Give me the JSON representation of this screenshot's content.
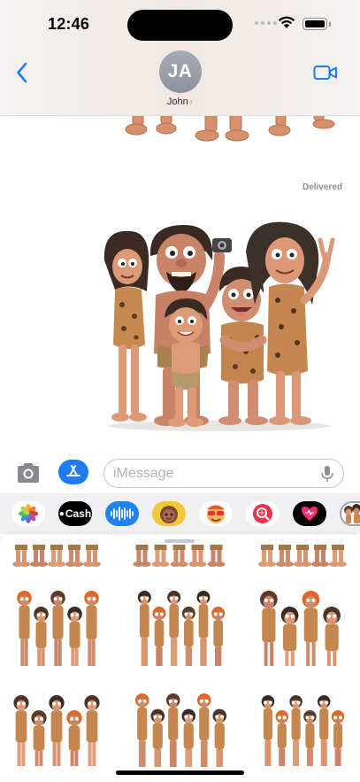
{
  "status_bar": {
    "time": "12:46"
  },
  "header": {
    "contact_initials": "JA",
    "contact_name": "John",
    "chevron": "›",
    "back_icon": "chevron-left-icon",
    "video_icon": "video-camera-icon"
  },
  "conversation": {
    "delivered_label": "Delivered"
  },
  "input_bar": {
    "placeholder": "iMessage",
    "camera_icon": "camera-icon",
    "apps_icon": "app-store-icon",
    "mic_icon": "microphone-icon"
  },
  "app_drawer": {
    "apps": [
      {
        "name": "Photos",
        "icon": "photos-icon"
      },
      {
        "name": "Cash",
        "label": "Cash",
        "icon": "apple-cash-icon"
      },
      {
        "name": "Audio",
        "icon": "audio-waveform-icon"
      },
      {
        "name": "Memoji",
        "icon": "memoji-icon"
      },
      {
        "name": "Memoji Stickers",
        "icon": "memoji-stickers-icon"
      },
      {
        "name": "Images",
        "icon": "image-search-icon"
      },
      {
        "name": "Fitness",
        "icon": "fitness-heart-icon"
      },
      {
        "name": "Stickers",
        "icon": "caveman-stickers-icon"
      }
    ]
  },
  "colors": {
    "accent_blue": "#1e7cf2",
    "avatar_gray": "#9ba1ab",
    "delivered_gray": "#8e8e93"
  }
}
